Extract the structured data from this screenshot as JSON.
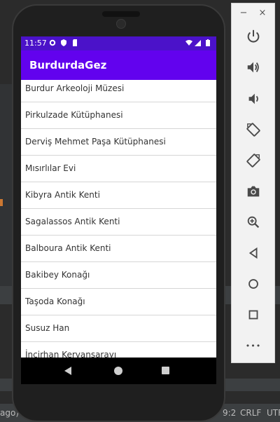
{
  "app": {
    "title": "BurdurdaGez"
  },
  "status_bar": {
    "time": "11:57"
  },
  "places": [
    "Burdur Arkeoloji Müzesi",
    "Pirkulzade Kütüphanesi",
    "Derviş Mehmet Paşa Kütüphanesi",
    "Mısırlılar Evi",
    "Kibyra Antik Kenti",
    "Sagalassos Antik Kenti",
    "Balboura Antik Kenti",
    "Bakibey Konağı",
    "Taşoda Konağı",
    "Susuz Han",
    "İncirhan Kervansarayı"
  ],
  "ide_status": {
    "left_fragment": "ago)",
    "position_fragment": "9:2",
    "line_ending": "CRLF",
    "encoding_fragment": "UTF"
  },
  "emulator_toolbar": {
    "minimize": "−",
    "close": "×",
    "more": "•••",
    "tools": [
      "power-icon",
      "volume-up-icon",
      "volume-down-icon",
      "rotate-left-icon",
      "rotate-right-icon",
      "camera-icon",
      "zoom-icon",
      "back-icon",
      "home-icon",
      "overview-icon"
    ]
  },
  "colors": {
    "status_bar": "#4b12c9",
    "app_bar": "#6202ee",
    "list_text": "#333333",
    "divider": "#d6d6d6"
  }
}
